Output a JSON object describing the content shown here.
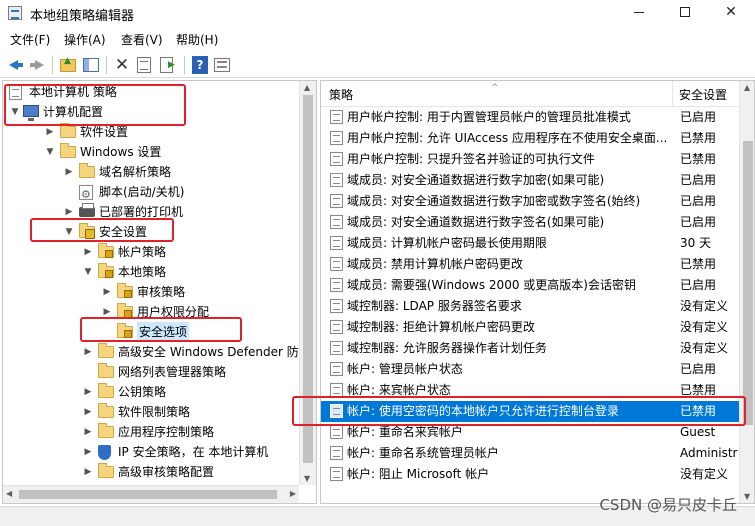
{
  "window": {
    "title": "本地组策略编辑器",
    "controls": {
      "minimize": "",
      "maximize": "",
      "close": "✕"
    }
  },
  "menubar": [
    "文件(F)",
    "操作(A)",
    "查看(V)",
    "帮助(H)"
  ],
  "toolbar": {
    "icons": [
      "back-arrow-icon",
      "forward-arrow-icon",
      "folder-up-icon",
      "show-pane-icon",
      "delete-icon",
      "properties-icon",
      "export-icon",
      "help-icon",
      "view-icon"
    ]
  },
  "tree": {
    "items": [
      {
        "label": "本地计算机 策略",
        "level": 0,
        "icon": "doc",
        "expander": ""
      },
      {
        "label": "计算机配置",
        "level": 0,
        "icon": "pc",
        "expander": "open"
      },
      {
        "label": "软件设置",
        "level": 1,
        "icon": "folder",
        "expander": "closed"
      },
      {
        "label": "Windows 设置",
        "level": 1,
        "icon": "folder",
        "expander": "open"
      },
      {
        "label": "域名解析策略",
        "level": 2,
        "icon": "folder",
        "expander": "closed"
      },
      {
        "label": "脚本(启动/关机)",
        "level": 2,
        "icon": "gear-doc",
        "expander": ""
      },
      {
        "label": "已部署的打印机",
        "level": 2,
        "icon": "printer",
        "expander": "closed"
      },
      {
        "label": "安全设置",
        "level": 2,
        "icon": "folder-secure",
        "expander": "open"
      },
      {
        "label": "帐户策略",
        "level": 3,
        "icon": "folder-lock",
        "expander": "closed"
      },
      {
        "label": "本地策略",
        "level": 3,
        "icon": "folder-lock",
        "expander": "open"
      },
      {
        "label": "审核策略",
        "level": 4,
        "icon": "folder-lock",
        "expander": "closed"
      },
      {
        "label": "用户权限分配",
        "level": 4,
        "icon": "folder-lock",
        "expander": "closed"
      },
      {
        "label": "安全选项",
        "level": 4,
        "icon": "folder-lock",
        "expander": "",
        "selected": true
      },
      {
        "label": "高级安全 Windows Defender 防火墙",
        "level": 3,
        "icon": "folder",
        "expander": "closed"
      },
      {
        "label": "网络列表管理器策略",
        "level": 3,
        "icon": "folder",
        "expander": ""
      },
      {
        "label": "公钥策略",
        "level": 3,
        "icon": "folder",
        "expander": "closed"
      },
      {
        "label": "软件限制策略",
        "level": 3,
        "icon": "folder",
        "expander": "closed"
      },
      {
        "label": "应用程序控制策略",
        "level": 3,
        "icon": "folder",
        "expander": "closed"
      },
      {
        "label": "IP 安全策略，在 本地计算机",
        "level": 3,
        "icon": "shield",
        "expander": "closed"
      },
      {
        "label": "高级审核策略配置",
        "level": 3,
        "icon": "folder",
        "expander": "closed"
      }
    ]
  },
  "list": {
    "columns": {
      "policy": "策略",
      "setting": "安全设置"
    },
    "rows": [
      {
        "name": "用户帐户控制: 用于内置管理员帐户的管理员批准模式",
        "setting": "已启用"
      },
      {
        "name": "用户帐户控制: 允许 UIAccess 应用程序在不使用安全桌面...",
        "setting": "已禁用"
      },
      {
        "name": "用户帐户控制: 只提升签名并验证的可执行文件",
        "setting": "已禁用"
      },
      {
        "name": "域成员: 对安全通道数据进行数字加密(如果可能)",
        "setting": "已启用"
      },
      {
        "name": "域成员: 对安全通道数据进行数字加密或数字签名(始终)",
        "setting": "已启用"
      },
      {
        "name": "域成员: 对安全通道数据进行数字签名(如果可能)",
        "setting": "已启用"
      },
      {
        "name": "域成员: 计算机帐户密码最长使用期限",
        "setting": "30 天"
      },
      {
        "name": "域成员: 禁用计算机帐户密码更改",
        "setting": "已禁用"
      },
      {
        "name": "域成员: 需要强(Windows 2000 或更高版本)会话密钥",
        "setting": "已启用"
      },
      {
        "name": "域控制器: LDAP 服务器签名要求",
        "setting": "没有定义"
      },
      {
        "name": "域控制器: 拒绝计算机帐户密码更改",
        "setting": "没有定义"
      },
      {
        "name": "域控制器: 允许服务器操作者计划任务",
        "setting": "没有定义"
      },
      {
        "name": "帐户: 管理员帐户状态",
        "setting": "已启用"
      },
      {
        "name": "帐户: 来宾帐户状态",
        "setting": "已禁用"
      },
      {
        "name": "帐户: 使用空密码的本地帐户只允许进行控制台登录",
        "setting": "已禁用",
        "selected": true
      },
      {
        "name": "帐户: 重命名来宾帐户",
        "setting": "Guest"
      },
      {
        "name": "帐户: 重命名系统管理员帐户",
        "setting": "Administr"
      },
      {
        "name": "帐户: 阻止 Microsoft 帐户",
        "setting": "没有定义"
      }
    ]
  },
  "watermark": "CSDN @易只皮卡丘",
  "colors": {
    "highlight_box": "#e0202a",
    "selection": "#0078d7",
    "tree_selection": "#cce8ff"
  }
}
